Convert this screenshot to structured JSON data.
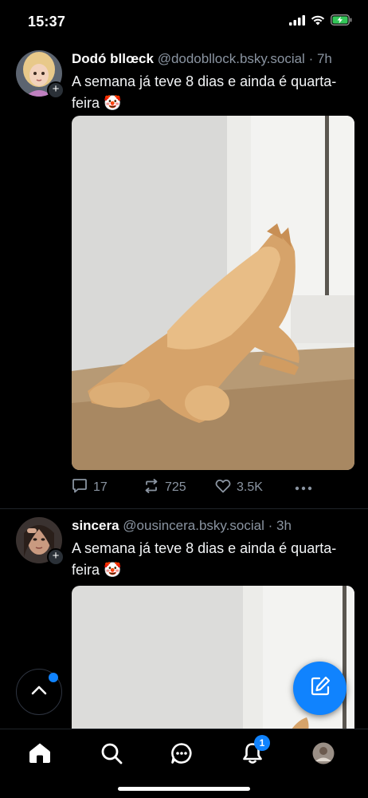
{
  "status_bar": {
    "time": "15:37"
  },
  "feed": {
    "posts": [
      {
        "display_name": "Dodó bllœck",
        "handle": "@dodobllock.bsky.social",
        "separator": "·",
        "time": "7h",
        "text": "A semana já teve 8 dias e ainda é quarta-feira 🤡",
        "avatar_plus": "+",
        "reply_count": "17",
        "repost_count": "725",
        "like_count": "3.5K"
      },
      {
        "display_name": "sincera",
        "handle": "@ousincera.bsky.social",
        "separator": "·",
        "time": "3h",
        "text": "A semana já teve 8 dias e ainda é quarta-feira 🤡",
        "avatar_plus": "+"
      }
    ]
  },
  "bottom_nav": {
    "items": [
      "home-icon",
      "search-icon",
      "chat-icon",
      "bell-icon",
      "profile-avatar"
    ],
    "notification_badge": "1"
  },
  "colors": {
    "accent": "#1083fe",
    "muted": "#8a94a1",
    "background": "#000000"
  }
}
